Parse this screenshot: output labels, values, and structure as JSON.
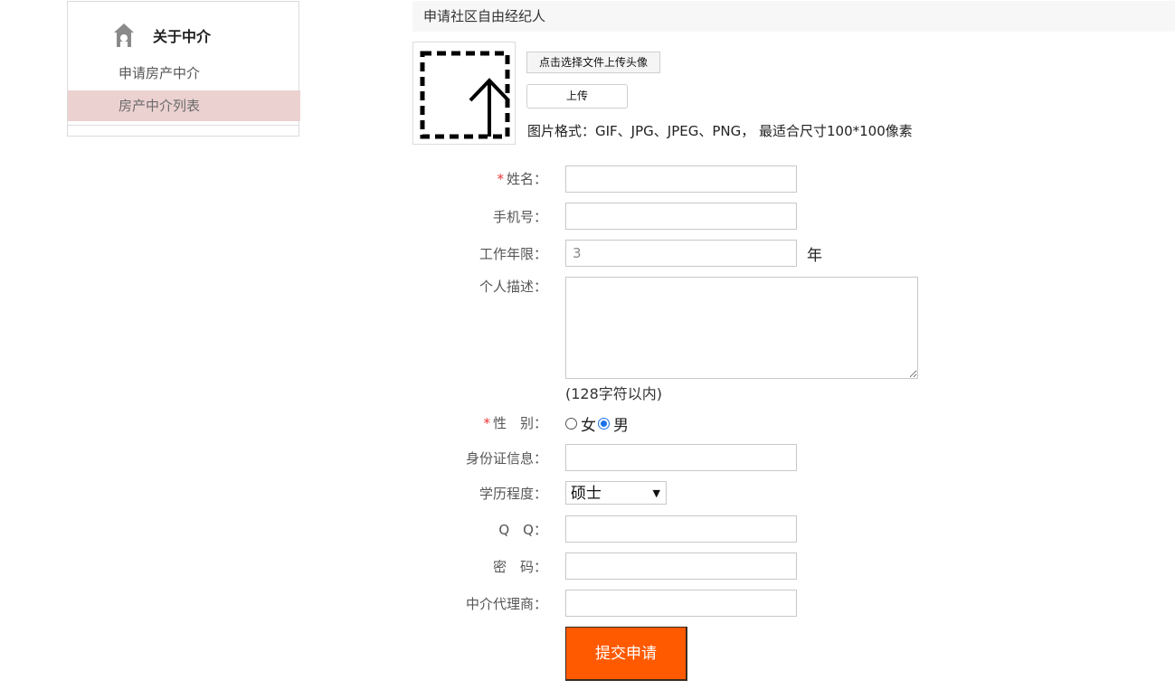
{
  "sidebar": {
    "title": "关于中介",
    "items": [
      {
        "label": "申请房产中介"
      },
      {
        "label": "房产中介列表"
      }
    ]
  },
  "main": {
    "title": "申请社区自由经纪人"
  },
  "avatar": {
    "choose_file_label": "点击选择文件上传头像",
    "upload_label": "上传",
    "format_note": "图片格式：GIF、JPG、JPEG、PNG， 最适合尺寸100*100像素"
  },
  "form": {
    "name_label": "姓名：",
    "phone_label": "手机号：",
    "years_label": "工作年限：",
    "years_placeholder": "3",
    "years_unit": "年",
    "desc_label": "个人描述：",
    "desc_limit": "(128字符以内)",
    "gender_label": "性　别：",
    "gender_options": {
      "female": "女",
      "male": "男"
    },
    "gender_selected": "男",
    "id_label": "身份证信息：",
    "edu_label": "学历程度：",
    "edu_value": "硕士",
    "qq_label": "Q　Q：",
    "password_label": "密　码：",
    "agent_label": "中介代理商：",
    "required_mark": "*",
    "submit_label": "提交申请"
  },
  "colors": {
    "submit_bg": "#ff5a00",
    "sidebar_active_bg": "#ecd1d1",
    "required": "#e33333",
    "radio_checked": "#1a73e8"
  }
}
